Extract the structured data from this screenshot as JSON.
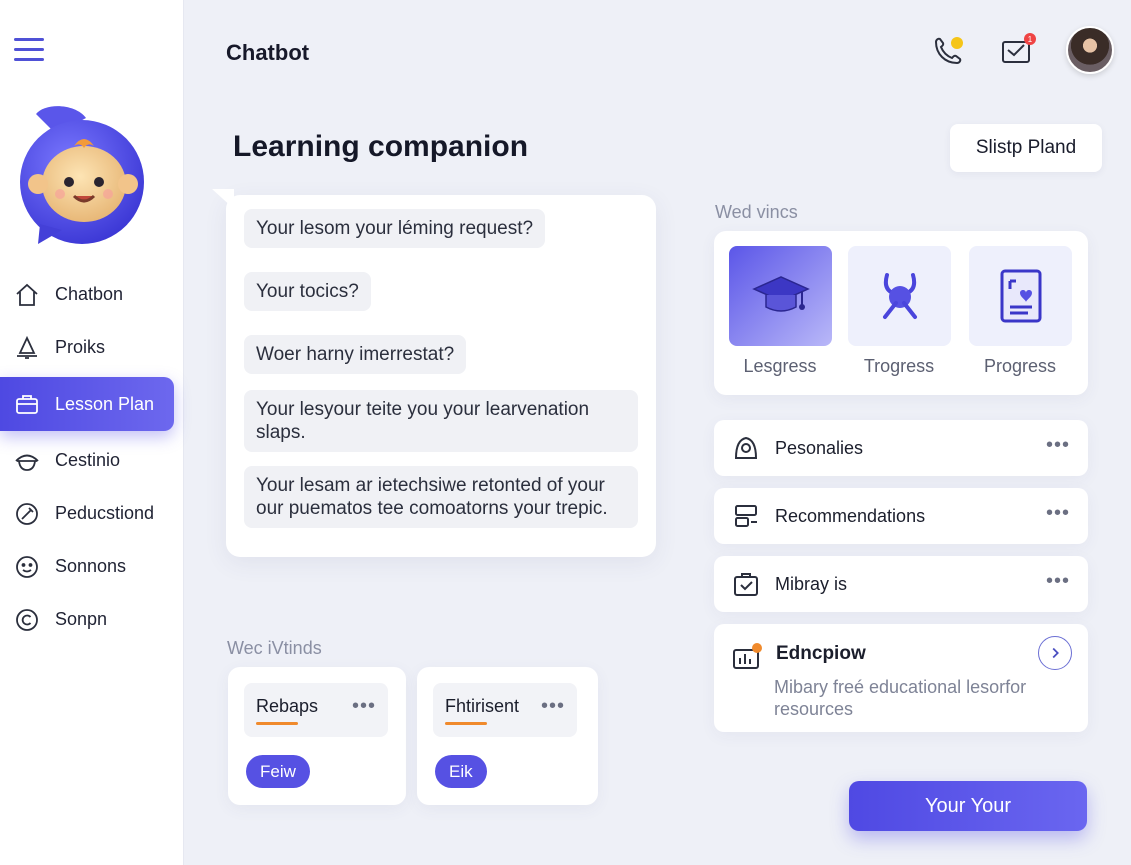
{
  "app": {
    "title": "Chatbot"
  },
  "header": {
    "call_badge_color": "#f5c518",
    "mail_badge_count": "1",
    "mail_badge_color": "#ef4444"
  },
  "sidebar": {
    "items": [
      {
        "label": "Chatbon",
        "icon": "home-icon"
      },
      {
        "label": "Proiks",
        "icon": "bell-icon"
      },
      {
        "label": "Lesson Plan",
        "icon": "briefcase-icon",
        "active": true
      },
      {
        "label": "Cestinio",
        "icon": "cap-icon"
      },
      {
        "label": "Peducstiond",
        "icon": "pencil-icon"
      },
      {
        "label": "Sonnons",
        "icon": "smile-icon"
      },
      {
        "label": "Sonpn",
        "icon": "copyright-icon"
      }
    ]
  },
  "main": {
    "title": "Learning companion",
    "plan_button": "Slistp Pland",
    "chat": [
      "Your lesom your léming request?",
      "Your tocics?",
      "Woer harny imerrestat?",
      "Your lesyour teite you your learvenation slaps.",
      "Your lesam ar ietechsiwe retonted of your our puematos tee comoatorns your trepic."
    ],
    "cards_label": "Wec iVtinds",
    "mini_cards": [
      {
        "title": "Rebaps",
        "button": "Feiw"
      },
      {
        "title": "Fhtirisent",
        "button": "Eik"
      }
    ]
  },
  "right": {
    "section_label": "Wed vincs",
    "tiles": [
      {
        "label": "Lesgress",
        "icon": "graduation-cap-icon",
        "active": true
      },
      {
        "label": "Trogress",
        "icon": "compass-tools-icon"
      },
      {
        "label": "Progress",
        "icon": "document-icon"
      }
    ],
    "list": [
      {
        "label": "Pesonalies",
        "icon": "person-icon"
      },
      {
        "label": "Recommendations",
        "icon": "cards-icon"
      },
      {
        "label": "Mibray is",
        "icon": "clipboard-icon"
      }
    ],
    "edu": {
      "title": "Edncpiow",
      "description": "Mibary freé educational lesorfor resources",
      "icon": "chart-icon"
    },
    "primary_button": "Your Your"
  },
  "colors": {
    "accent": "#5651e3",
    "highlight": "#f08a2c"
  }
}
